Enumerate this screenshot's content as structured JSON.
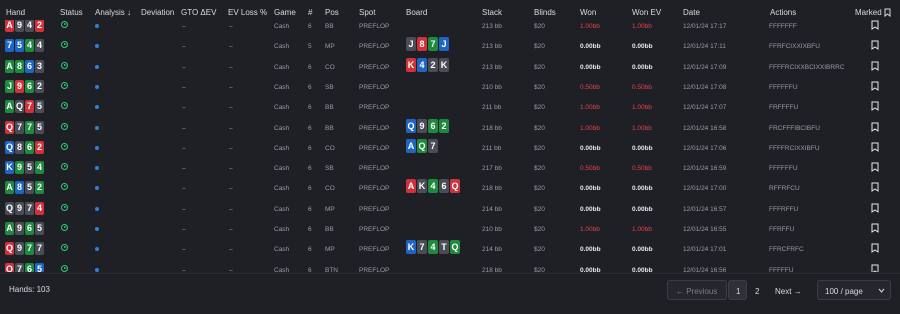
{
  "header": {
    "hand": "Hand",
    "status": "Status",
    "analysis": "Analysis ↓",
    "deviation": "Deviation",
    "gto_ev": "GTO ΔEV",
    "ev_loss": "EV Loss %",
    "game": "Game",
    "num": "#",
    "pos": "Pos",
    "spot": "Spot",
    "board": "Board",
    "stack": "Stack",
    "blinds": "Blinds",
    "won": "Won",
    "won_ev": "Won EV",
    "date": "Date",
    "actions": "Actions",
    "marked": "Marked"
  },
  "colors": {
    "heart": "#d0313a",
    "spade": "#4a4d56",
    "diamond": "#1f66c4",
    "club": "#1e8a3e",
    "accent": "#2f7fd8",
    "negative": "#e34545"
  },
  "rows": [
    {
      "cards": [
        [
          "A",
          "h"
        ],
        [
          "9",
          "s"
        ],
        [
          "4",
          "s"
        ],
        [
          "2",
          "h"
        ]
      ],
      "gto": "–",
      "evl": "–",
      "game": "Cash",
      "num": "6",
      "pos": "BB",
      "spot": "PREFLOP",
      "board": [],
      "stack": "213 bb",
      "blinds": "$20",
      "won": "1.00bb",
      "won_neg": true,
      "wonev": "1.00bb",
      "wonev_neg": true,
      "date": "12/01/24 17:17",
      "actions": "FFFFFFF"
    },
    {
      "cards": [
        [
          "7",
          "d"
        ],
        [
          "5",
          "d"
        ],
        [
          "4",
          "c"
        ],
        [
          "4",
          "s"
        ]
      ],
      "gto": "–",
      "evl": "–",
      "game": "Cash",
      "num": "5",
      "pos": "MP",
      "spot": "PREFLOP",
      "board": [
        [
          "J",
          "s"
        ],
        [
          "8",
          "h"
        ],
        [
          "7",
          "c"
        ],
        [
          "J",
          "d"
        ]
      ],
      "stack": "213 bb",
      "blinds": "$20",
      "won": "0.00bb",
      "won_neg": false,
      "wonev": "0.00bb",
      "wonev_neg": false,
      "date": "12/01/24 17:11",
      "actions": "FFRFCIXXIXBFU"
    },
    {
      "cards": [
        [
          "A",
          "c"
        ],
        [
          "8",
          "c"
        ],
        [
          "6",
          "d"
        ],
        [
          "3",
          "s"
        ]
      ],
      "gto": "–",
      "evl": "–",
      "game": "Cash",
      "num": "6",
      "pos": "CO",
      "spot": "PREFLOP",
      "board": [
        [
          "K",
          "h"
        ],
        [
          "4",
          "d"
        ],
        [
          "2",
          "s"
        ],
        [
          "K",
          "s"
        ]
      ],
      "stack": "213 bb",
      "blinds": "$20",
      "won": "0.00bb",
      "won_neg": false,
      "wonev": "0.00bb",
      "wonev_neg": false,
      "date": "12/01/24 17:09",
      "actions": "FFFFRCIXXBCIXXIBRRC"
    },
    {
      "cards": [
        [
          "J",
          "c"
        ],
        [
          "9",
          "h"
        ],
        [
          "6",
          "c"
        ],
        [
          "2",
          "s"
        ]
      ],
      "gto": "–",
      "evl": "–",
      "game": "Cash",
      "num": "6",
      "pos": "SB",
      "spot": "PREFLOP",
      "board": [],
      "stack": "210 bb",
      "blinds": "$20",
      "won": "0.50bb",
      "won_neg": true,
      "wonev": "0.50bb",
      "wonev_neg": true,
      "date": "12/01/24 17:08",
      "actions": "FFFFFFU"
    },
    {
      "cards": [
        [
          "A",
          "c"
        ],
        [
          "Q",
          "s"
        ],
        [
          "7",
          "h"
        ],
        [
          "5",
          "s"
        ]
      ],
      "gto": "–",
      "evl": "–",
      "game": "Cash",
      "num": "6",
      "pos": "BB",
      "spot": "PREFLOP",
      "board": [],
      "stack": "211 bb",
      "blinds": "$20",
      "won": "1.00bb",
      "won_neg": true,
      "wonev": "1.00bb",
      "wonev_neg": true,
      "date": "12/01/24 17:07",
      "actions": "FRFFFFU"
    },
    {
      "cards": [
        [
          "Q",
          "h"
        ],
        [
          "7",
          "s"
        ],
        [
          "7",
          "c"
        ],
        [
          "5",
          "s"
        ]
      ],
      "gto": "–",
      "evl": "–",
      "game": "Cash",
      "num": "6",
      "pos": "BB",
      "spot": "PREFLOP",
      "board": [
        [
          "Q",
          "d"
        ],
        [
          "9",
          "s"
        ],
        [
          "6",
          "c"
        ],
        [
          "2",
          "c"
        ]
      ],
      "stack": "218 bb",
      "blinds": "$20",
      "won": "1.00bb",
      "won_neg": true,
      "wonev": "1.00bb",
      "wonev_neg": true,
      "date": "12/01/24 16:58",
      "actions": "FRCFFFIBCIBFU"
    },
    {
      "cards": [
        [
          "Q",
          "d"
        ],
        [
          "8",
          "s"
        ],
        [
          "6",
          "c"
        ],
        [
          "2",
          "h"
        ]
      ],
      "gto": "–",
      "evl": "–",
      "game": "Cash",
      "num": "6",
      "pos": "CO",
      "spot": "PREFLOP",
      "board": [
        [
          "A",
          "d"
        ],
        [
          "Q",
          "c"
        ],
        [
          "7",
          "s"
        ]
      ],
      "stack": "211 bb",
      "blinds": "$20",
      "won": "0.00bb",
      "won_neg": false,
      "wonev": "0.00bb",
      "wonev_neg": false,
      "date": "12/01/24 17:06",
      "actions": "FFFFRCIXXIBFU"
    },
    {
      "cards": [
        [
          "K",
          "d"
        ],
        [
          "9",
          "c"
        ],
        [
          "5",
          "s"
        ],
        [
          "4",
          "c"
        ]
      ],
      "gto": "–",
      "evl": "–",
      "game": "Cash",
      "num": "6",
      "pos": "SB",
      "spot": "PREFLOP",
      "board": [],
      "stack": "217 bb",
      "blinds": "$20",
      "won": "0.50bb",
      "won_neg": true,
      "wonev": "0.50bb",
      "wonev_neg": true,
      "date": "12/01/24 16:59",
      "actions": "FFFFFFU"
    },
    {
      "cards": [
        [
          "A",
          "c"
        ],
        [
          "8",
          "d"
        ],
        [
          "5",
          "s"
        ],
        [
          "2",
          "c"
        ]
      ],
      "gto": "–",
      "evl": "–",
      "game": "Cash",
      "num": "6",
      "pos": "CO",
      "spot": "PREFLOP",
      "board": [
        [
          "A",
          "h"
        ],
        [
          "K",
          "s"
        ],
        [
          "4",
          "c"
        ],
        [
          "6",
          "s"
        ],
        [
          "Q",
          "h"
        ]
      ],
      "stack": "218 bb",
      "blinds": "$20",
      "won": "0.00bb",
      "won_neg": false,
      "wonev": "0.00bb",
      "wonev_neg": false,
      "date": "12/01/24 17:00",
      "actions": "RFFRFCU"
    },
    {
      "cards": [
        [
          "Q",
          "s"
        ],
        [
          "9",
          "s"
        ],
        [
          "7",
          "s"
        ],
        [
          "4",
          "h"
        ]
      ],
      "gto": "–",
      "evl": "–",
      "game": "Cash",
      "num": "6",
      "pos": "MP",
      "spot": "PREFLOP",
      "board": [],
      "stack": "214 bb",
      "blinds": "$20",
      "won": "0.00bb",
      "won_neg": false,
      "wonev": "0.00bb",
      "wonev_neg": false,
      "date": "12/01/24 16:57",
      "actions": "FFFRFFU"
    },
    {
      "cards": [
        [
          "A",
          "c"
        ],
        [
          "9",
          "s"
        ],
        [
          "6",
          "c"
        ],
        [
          "5",
          "s"
        ]
      ],
      "gto": "–",
      "evl": "–",
      "game": "Cash",
      "num": "6",
      "pos": "BB",
      "spot": "PREFLOP",
      "board": [],
      "stack": "210 bb",
      "blinds": "$20",
      "won": "1.00bb",
      "won_neg": true,
      "wonev": "1.00bb",
      "wonev_neg": true,
      "date": "12/01/24 16:55",
      "actions": "FFRFFU"
    },
    {
      "cards": [
        [
          "Q",
          "h"
        ],
        [
          "9",
          "s"
        ],
        [
          "7",
          "c"
        ],
        [
          "7",
          "s"
        ]
      ],
      "gto": "–",
      "evl": "–",
      "game": "Cash",
      "num": "6",
      "pos": "MP",
      "spot": "PREFLOP",
      "board": [
        [
          "K",
          "d"
        ],
        [
          "7",
          "s"
        ],
        [
          "4",
          "c"
        ],
        [
          "T",
          "s"
        ],
        [
          "Q",
          "c"
        ]
      ],
      "stack": "214 bb",
      "blinds": "$20",
      "won": "0.00bb",
      "won_neg": false,
      "wonev": "0.00bb",
      "wonev_neg": false,
      "date": "12/01/24 17:01",
      "actions": "FFRCFRFC"
    },
    {
      "cards": [
        [
          "Q",
          "h"
        ],
        [
          "7",
          "s"
        ],
        [
          "6",
          "c"
        ],
        [
          "5",
          "d"
        ]
      ],
      "gto": "–",
      "evl": "–",
      "game": "Cash",
      "num": "6",
      "pos": "BTN",
      "spot": "PREFLOP",
      "board": [],
      "stack": "218 bb",
      "blinds": "$20",
      "won": "0.00bb",
      "won_neg": false,
      "wonev": "0.00bb",
      "wonev_neg": false,
      "date": "12/01/24 16:56",
      "actions": "FFFFFU"
    }
  ],
  "footer": {
    "hands": "Hands: 103",
    "previous": "← Previous",
    "page1": "1",
    "page2": "2",
    "next": "Next →",
    "per_page": "100 / page"
  }
}
